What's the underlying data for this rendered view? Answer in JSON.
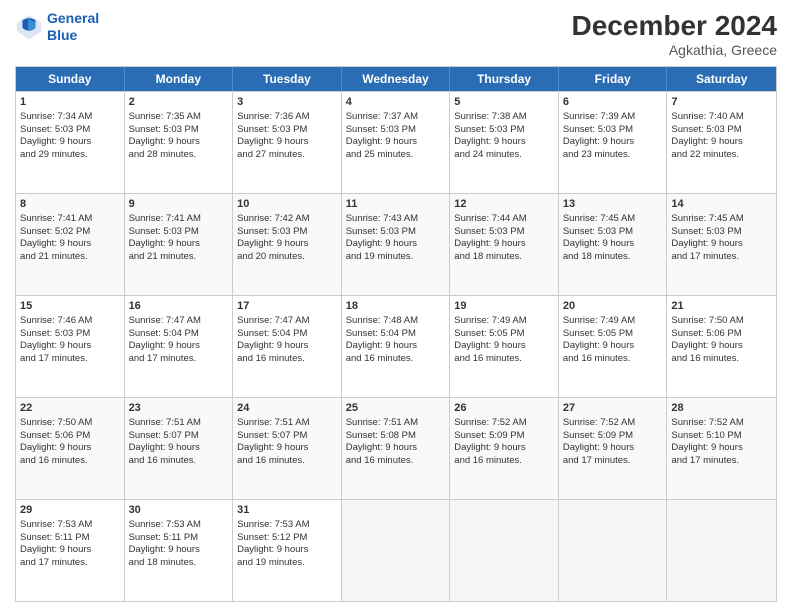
{
  "logo": {
    "line1": "General",
    "line2": "Blue"
  },
  "title": "December 2024",
  "subtitle": "Agkathia, Greece",
  "headers": [
    "Sunday",
    "Monday",
    "Tuesday",
    "Wednesday",
    "Thursday",
    "Friday",
    "Saturday"
  ],
  "weeks": [
    [
      {
        "day": "1",
        "lines": [
          "Sunrise: 7:34 AM",
          "Sunset: 5:03 PM",
          "Daylight: 9 hours",
          "and 29 minutes."
        ]
      },
      {
        "day": "2",
        "lines": [
          "Sunrise: 7:35 AM",
          "Sunset: 5:03 PM",
          "Daylight: 9 hours",
          "and 28 minutes."
        ]
      },
      {
        "day": "3",
        "lines": [
          "Sunrise: 7:36 AM",
          "Sunset: 5:03 PM",
          "Daylight: 9 hours",
          "and 27 minutes."
        ]
      },
      {
        "day": "4",
        "lines": [
          "Sunrise: 7:37 AM",
          "Sunset: 5:03 PM",
          "Daylight: 9 hours",
          "and 25 minutes."
        ]
      },
      {
        "day": "5",
        "lines": [
          "Sunrise: 7:38 AM",
          "Sunset: 5:03 PM",
          "Daylight: 9 hours",
          "and 24 minutes."
        ]
      },
      {
        "day": "6",
        "lines": [
          "Sunrise: 7:39 AM",
          "Sunset: 5:03 PM",
          "Daylight: 9 hours",
          "and 23 minutes."
        ]
      },
      {
        "day": "7",
        "lines": [
          "Sunrise: 7:40 AM",
          "Sunset: 5:03 PM",
          "Daylight: 9 hours",
          "and 22 minutes."
        ]
      }
    ],
    [
      {
        "day": "8",
        "lines": [
          "Sunrise: 7:41 AM",
          "Sunset: 5:02 PM",
          "Daylight: 9 hours",
          "and 21 minutes."
        ]
      },
      {
        "day": "9",
        "lines": [
          "Sunrise: 7:41 AM",
          "Sunset: 5:03 PM",
          "Daylight: 9 hours",
          "and 21 minutes."
        ]
      },
      {
        "day": "10",
        "lines": [
          "Sunrise: 7:42 AM",
          "Sunset: 5:03 PM",
          "Daylight: 9 hours",
          "and 20 minutes."
        ]
      },
      {
        "day": "11",
        "lines": [
          "Sunrise: 7:43 AM",
          "Sunset: 5:03 PM",
          "Daylight: 9 hours",
          "and 19 minutes."
        ]
      },
      {
        "day": "12",
        "lines": [
          "Sunrise: 7:44 AM",
          "Sunset: 5:03 PM",
          "Daylight: 9 hours",
          "and 18 minutes."
        ]
      },
      {
        "day": "13",
        "lines": [
          "Sunrise: 7:45 AM",
          "Sunset: 5:03 PM",
          "Daylight: 9 hours",
          "and 18 minutes."
        ]
      },
      {
        "day": "14",
        "lines": [
          "Sunrise: 7:45 AM",
          "Sunset: 5:03 PM",
          "Daylight: 9 hours",
          "and 17 minutes."
        ]
      }
    ],
    [
      {
        "day": "15",
        "lines": [
          "Sunrise: 7:46 AM",
          "Sunset: 5:03 PM",
          "Daylight: 9 hours",
          "and 17 minutes."
        ]
      },
      {
        "day": "16",
        "lines": [
          "Sunrise: 7:47 AM",
          "Sunset: 5:04 PM",
          "Daylight: 9 hours",
          "and 17 minutes."
        ]
      },
      {
        "day": "17",
        "lines": [
          "Sunrise: 7:47 AM",
          "Sunset: 5:04 PM",
          "Daylight: 9 hours",
          "and 16 minutes."
        ]
      },
      {
        "day": "18",
        "lines": [
          "Sunrise: 7:48 AM",
          "Sunset: 5:04 PM",
          "Daylight: 9 hours",
          "and 16 minutes."
        ]
      },
      {
        "day": "19",
        "lines": [
          "Sunrise: 7:49 AM",
          "Sunset: 5:05 PM",
          "Daylight: 9 hours",
          "and 16 minutes."
        ]
      },
      {
        "day": "20",
        "lines": [
          "Sunrise: 7:49 AM",
          "Sunset: 5:05 PM",
          "Daylight: 9 hours",
          "and 16 minutes."
        ]
      },
      {
        "day": "21",
        "lines": [
          "Sunrise: 7:50 AM",
          "Sunset: 5:06 PM",
          "Daylight: 9 hours",
          "and 16 minutes."
        ]
      }
    ],
    [
      {
        "day": "22",
        "lines": [
          "Sunrise: 7:50 AM",
          "Sunset: 5:06 PM",
          "Daylight: 9 hours",
          "and 16 minutes."
        ]
      },
      {
        "day": "23",
        "lines": [
          "Sunrise: 7:51 AM",
          "Sunset: 5:07 PM",
          "Daylight: 9 hours",
          "and 16 minutes."
        ]
      },
      {
        "day": "24",
        "lines": [
          "Sunrise: 7:51 AM",
          "Sunset: 5:07 PM",
          "Daylight: 9 hours",
          "and 16 minutes."
        ]
      },
      {
        "day": "25",
        "lines": [
          "Sunrise: 7:51 AM",
          "Sunset: 5:08 PM",
          "Daylight: 9 hours",
          "and 16 minutes."
        ]
      },
      {
        "day": "26",
        "lines": [
          "Sunrise: 7:52 AM",
          "Sunset: 5:09 PM",
          "Daylight: 9 hours",
          "and 16 minutes."
        ]
      },
      {
        "day": "27",
        "lines": [
          "Sunrise: 7:52 AM",
          "Sunset: 5:09 PM",
          "Daylight: 9 hours",
          "and 17 minutes."
        ]
      },
      {
        "day": "28",
        "lines": [
          "Sunrise: 7:52 AM",
          "Sunset: 5:10 PM",
          "Daylight: 9 hours",
          "and 17 minutes."
        ]
      }
    ],
    [
      {
        "day": "29",
        "lines": [
          "Sunrise: 7:53 AM",
          "Sunset: 5:11 PM",
          "Daylight: 9 hours",
          "and 17 minutes."
        ]
      },
      {
        "day": "30",
        "lines": [
          "Sunrise: 7:53 AM",
          "Sunset: 5:11 PM",
          "Daylight: 9 hours",
          "and 18 minutes."
        ]
      },
      {
        "day": "31",
        "lines": [
          "Sunrise: 7:53 AM",
          "Sunset: 5:12 PM",
          "Daylight: 9 hours",
          "and 19 minutes."
        ]
      },
      null,
      null,
      null,
      null
    ]
  ]
}
